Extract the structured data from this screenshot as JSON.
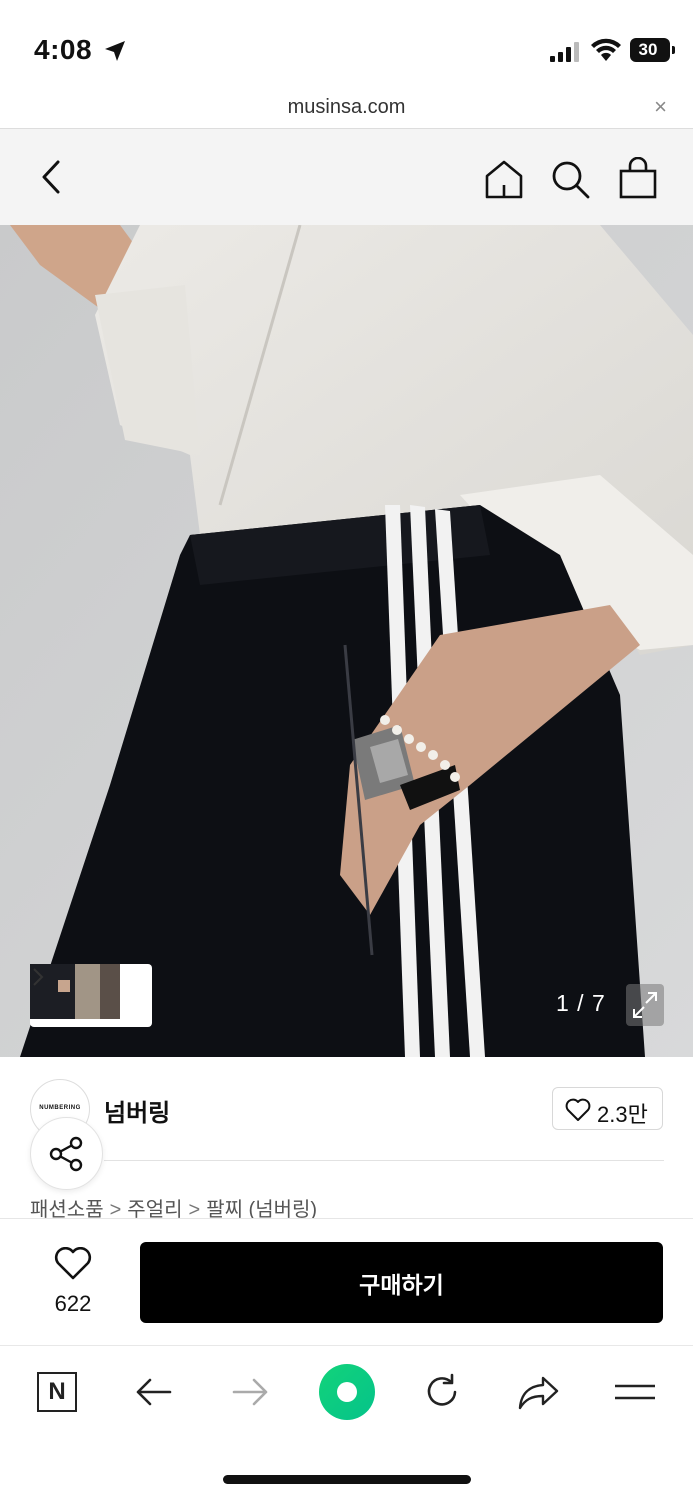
{
  "status_bar": {
    "time": "4:08",
    "battery": "30",
    "icons": [
      "location-arrow-icon",
      "signal-icon",
      "wifi-icon",
      "battery-icon"
    ]
  },
  "url_bar": {
    "url": "musinsa.com",
    "close_label": "×"
  },
  "header": {
    "icons": [
      "back-chevron-icon",
      "home-icon",
      "search-icon",
      "shopping-bag-icon"
    ]
  },
  "gallery": {
    "counter": "1 / 7",
    "icons": [
      "thumbnail-chevron-icon",
      "expand-icon"
    ]
  },
  "brand": {
    "logo_text": "NUMBERING",
    "name": "넘버링",
    "likes": "2.3만"
  },
  "breadcrumb": {
    "items": [
      "패션소품",
      "주얼리",
      "팔찌 (넘버링)"
    ],
    "separator": ">"
  },
  "purchase": {
    "wish_count": "622",
    "buy_label": "구매하기"
  },
  "browser_toolbar": {
    "n_label": "N",
    "icons": [
      "naver-n-icon",
      "back-arrow-icon",
      "forward-arrow-icon",
      "green-dot-icon",
      "reload-icon",
      "share-arrow-icon",
      "menu-icon"
    ]
  },
  "colors": {
    "buy_button": "#000000",
    "header_bg": "#f4f4f4",
    "green_dot": "#12d37a"
  }
}
